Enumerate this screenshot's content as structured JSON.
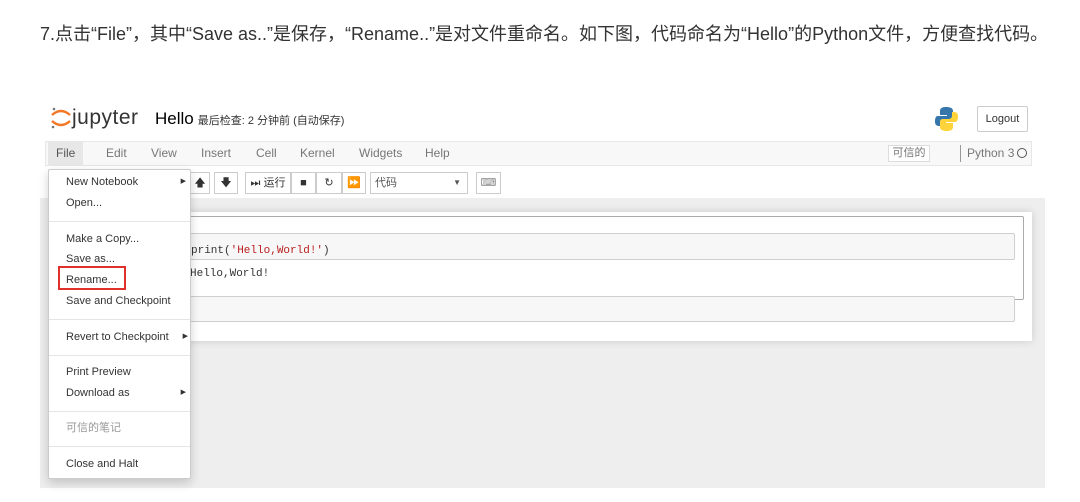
{
  "paragraph": "7.点击“File”，其中“Save as..”是保存，“Rename..”是对文件重命名。如下图，代码命名为“Hello”的Python文件，方便查找代码。",
  "header": {
    "logo": "jupyter",
    "notebook_name": "Hello",
    "checkpoint": "最后检查: 2 分钟前  (自动保存)",
    "logout": "Logout",
    "python_logo_icon": "python-logo"
  },
  "menubar": {
    "items": [
      "File",
      "Edit",
      "View",
      "Insert",
      "Cell",
      "Kernel",
      "Widgets",
      "Help"
    ],
    "trusted": "可信的",
    "kernel": "Python 3"
  },
  "toolbar": {
    "run": "运行",
    "cell_type": "代码"
  },
  "cells": {
    "code_prefix": "print(",
    "code_string": "'Hello,World!'",
    "code_suffix": ")",
    "output": "Hello,World!"
  },
  "file_menu": {
    "new_notebook": "New Notebook",
    "open": "Open...",
    "make_copy": "Make a Copy...",
    "save_as": "Save as...",
    "rename": "Rename...",
    "save_checkpoint": "Save and Checkpoint",
    "revert": "Revert to Checkpoint",
    "print_preview": "Print Preview",
    "download_as": "Download as",
    "trusted_notebook": "可信的笔记",
    "close_halt": "Close and Halt"
  },
  "colors": {
    "highlight": "#e0302c",
    "jupyter_orange": "#f37726",
    "string_red": "#ba2121"
  }
}
